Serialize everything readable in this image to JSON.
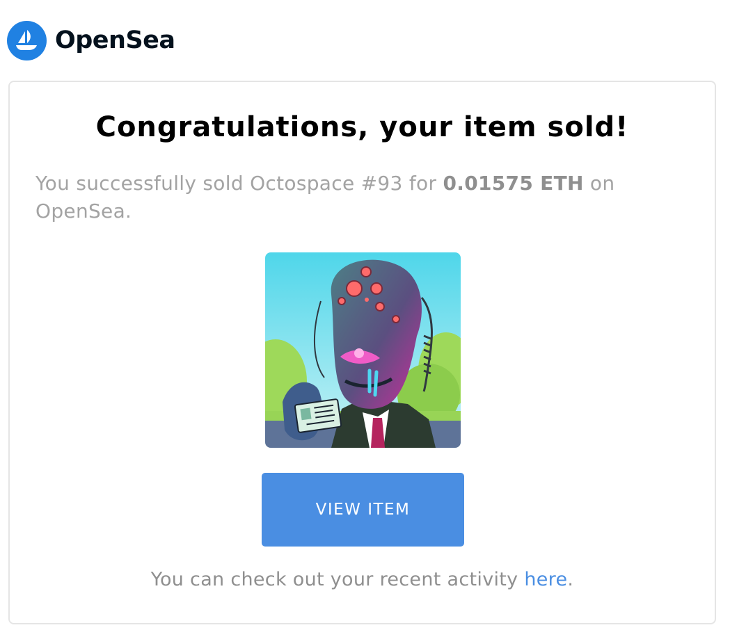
{
  "brand": {
    "name": "OpenSea",
    "logo_icon": "opensea-boat-icon",
    "logo_color": "#2081e2"
  },
  "email": {
    "headline": "Congratulations, your item sold!",
    "message": {
      "prefix": "You successfully sold Octospace #93 for ",
      "price": "0.01575 ETH",
      "suffix": " on OpenSea."
    },
    "item_image": {
      "alt": "Octospace #93"
    },
    "view_button": {
      "label": "VIEW ITEM",
      "color": "#4a8ee2"
    },
    "activity": {
      "prefix": "You can check out your recent activity ",
      "link_text": "here",
      "suffix": "."
    }
  }
}
